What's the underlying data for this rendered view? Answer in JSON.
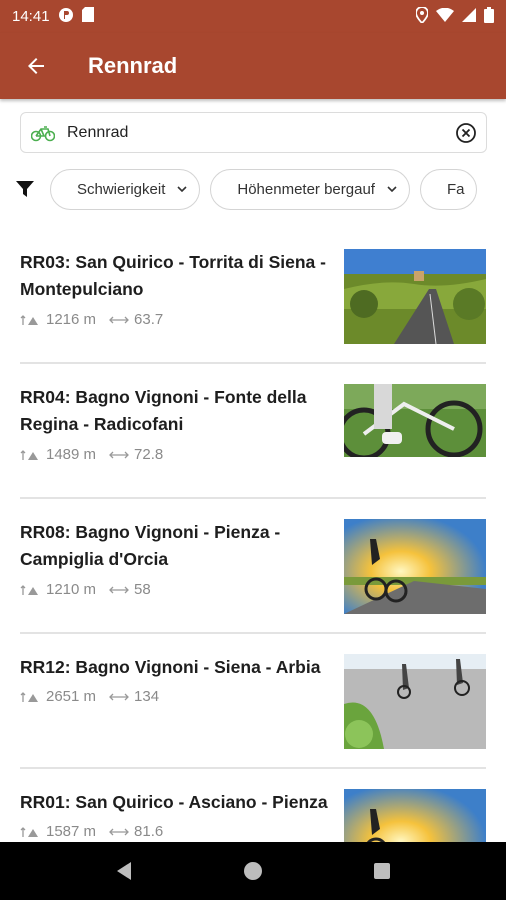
{
  "status_bar": {
    "time": "14:41"
  },
  "app_bar": {
    "title": "Rennrad"
  },
  "search": {
    "value": "Rennrad"
  },
  "filters": [
    {
      "label": "Schwierigkeit"
    },
    {
      "label": "Höhenmeter bergauf"
    },
    {
      "label": "Fa"
    }
  ],
  "routes": [
    {
      "title": "RR03: San Quirico - Torrita di Siena - Montepulciano",
      "ascent": "1216 m",
      "distance": "63.7",
      "image": "landscape-road-photo"
    },
    {
      "title": "RR04: Bagno Vignoni - Fonte della Regina - Radicofani",
      "ascent": "1489 m",
      "distance": "72.8",
      "image": "cyclist-closeup-photo"
    },
    {
      "title": "RR08: Bagno Vignoni - Pienza - Campiglia d'Orcia",
      "ascent": "1210 m",
      "distance": "58",
      "image": "cyclist-sunset-photo"
    },
    {
      "title": "RR12: Bagno Vignoni - Siena - Arbia",
      "ascent": "2651 m",
      "distance": "134",
      "image": "cyclists-road-photo"
    },
    {
      "title": "RR01: San Quirico - Asciano - Pienza",
      "ascent": "1587 m",
      "distance": "81.6",
      "image": "cyclist-sunset-photo"
    }
  ],
  "colors": {
    "app_bar": "#a8472f",
    "bike_icon": "#4caf50"
  }
}
